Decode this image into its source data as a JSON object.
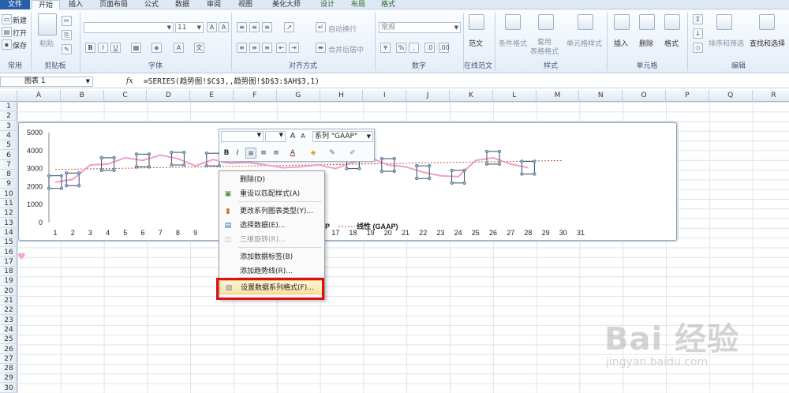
{
  "tabs": [
    {
      "label": "文件",
      "active": false,
      "kind": "file"
    },
    {
      "label": "开始",
      "active": true,
      "kind": "normal"
    },
    {
      "label": "插入",
      "active": false,
      "kind": "normal"
    },
    {
      "label": "页面布局",
      "active": false,
      "kind": "normal"
    },
    {
      "label": "公式",
      "active": false,
      "kind": "normal"
    },
    {
      "label": "数据",
      "active": false,
      "kind": "normal"
    },
    {
      "label": "审阅",
      "active": false,
      "kind": "normal"
    },
    {
      "label": "视图",
      "active": false,
      "kind": "normal"
    },
    {
      "label": "美化大师",
      "active": false,
      "kind": "normal"
    },
    {
      "label": "设计",
      "active": false,
      "kind": "context"
    },
    {
      "label": "布局",
      "active": false,
      "kind": "context"
    },
    {
      "label": "格式",
      "active": false,
      "kind": "context"
    }
  ],
  "ribbon": {
    "common": {
      "items": [
        "新建",
        "打开",
        "保存"
      ],
      "label": "常用"
    },
    "clipboard": {
      "paste": "粘贴",
      "label": "剪贴板"
    },
    "font": {
      "size": "11",
      "label": "字体"
    },
    "align": {
      "wrap": "自动换行",
      "merge": "合并后居中",
      "label": "对齐方式"
    },
    "number": {
      "format": "常规",
      "label": "数字"
    },
    "template": {
      "name": "范文",
      "label": "在线范文"
    },
    "styles": {
      "cond": "条件格式",
      "table": "套用\n表格格式",
      "cell": "单元格样式",
      "label": "样式"
    },
    "cells": {
      "insert": "插入",
      "delete": "删除",
      "format": "格式",
      "label": "单元格"
    },
    "edit": {
      "sort": "排序和筛选",
      "find": "查找和选择",
      "label": "编辑"
    }
  },
  "formula_bar": {
    "name_box": "图表 1",
    "fx": "fx",
    "formula": "=SERIES(趋势图!$C$3,,趋势图!$D$3:$AH$3,1)"
  },
  "columns": [
    "A",
    "B",
    "C",
    "D",
    "E",
    "F",
    "G",
    "H",
    "I",
    "J",
    "K",
    "L",
    "M",
    "N",
    "O",
    "P",
    "Q",
    "R"
  ],
  "rows": [
    "1",
    "2",
    "3",
    "4",
    "5",
    "6",
    "7",
    "8",
    "9",
    "10",
    "11",
    "12",
    "13",
    "14",
    "15",
    "16",
    "17",
    "18",
    "19",
    "20",
    "21",
    "22",
    "23",
    "24",
    "25",
    "26",
    "27",
    "28",
    "29",
    "30"
  ],
  "chart_data": {
    "type": "line",
    "x": [
      1,
      2,
      3,
      4,
      5,
      6,
      7,
      8,
      9,
      10,
      11,
      12,
      13,
      14,
      15,
      16,
      17,
      18,
      19,
      20,
      21,
      22,
      23,
      24,
      25,
      26,
      27,
      28,
      29,
      30,
      31
    ],
    "ylim": [
      0,
      5000
    ],
    "y_ticks": [
      "5000",
      "4000",
      "3000",
      "2000",
      "1000",
      "0"
    ],
    "series": [
      {
        "name": "GAAP",
        "color": "#f0a0c8",
        "values": [
          2250,
          2400,
          3200,
          3250,
          3600,
          3450,
          3750,
          3550,
          3150,
          3500,
          3300,
          3350,
          3200,
          3050,
          3100,
          3200,
          3000,
          3350,
          3600,
          3200,
          3100,
          2800,
          2600,
          2550,
          3450,
          3600,
          3250,
          3050
        ]
      },
      {
        "name": "线性 (GAAP)",
        "kind": "trendline",
        "color": "#b06040",
        "values_start": 2950,
        "values_end": 3450
      }
    ],
    "legend_text": "线性 (GAAP)",
    "legend_partial": "P",
    "selected_markers": [
      1,
      2,
      4,
      6,
      8,
      10,
      18,
      20,
      22,
      24,
      26,
      28
    ]
  },
  "mini_toolbar": {
    "series_combo": "系列 \"GAAP\"",
    "font_inc": "A",
    "font_dec": "A",
    "bold": "B",
    "italic": "I",
    "font_color": "A"
  },
  "context_menu": [
    {
      "label": "删除(D)",
      "icon": "",
      "disabled": false
    },
    {
      "label": "重设以匹配样式(A)",
      "icon": "reset-style-icon",
      "disabled": false
    },
    {
      "label": "更改系列图表类型(Y)...",
      "icon": "chart-type-icon",
      "disabled": false
    },
    {
      "label": "选择数据(E)...",
      "icon": "select-data-icon",
      "disabled": false
    },
    {
      "label": "三维旋转(R)...",
      "icon": "rotate-3d-icon",
      "disabled": true
    },
    {
      "label": "添加数据标签(B)",
      "icon": "",
      "disabled": false
    },
    {
      "label": "添加趋势线(R)...",
      "icon": "",
      "disabled": false
    },
    {
      "label": "设置数据系列格式(F)...",
      "icon": "format-series-icon",
      "disabled": false,
      "selected": true
    }
  ],
  "watermark": {
    "brand": "Bai 经验",
    "url": "jingyan.baidu.com"
  }
}
